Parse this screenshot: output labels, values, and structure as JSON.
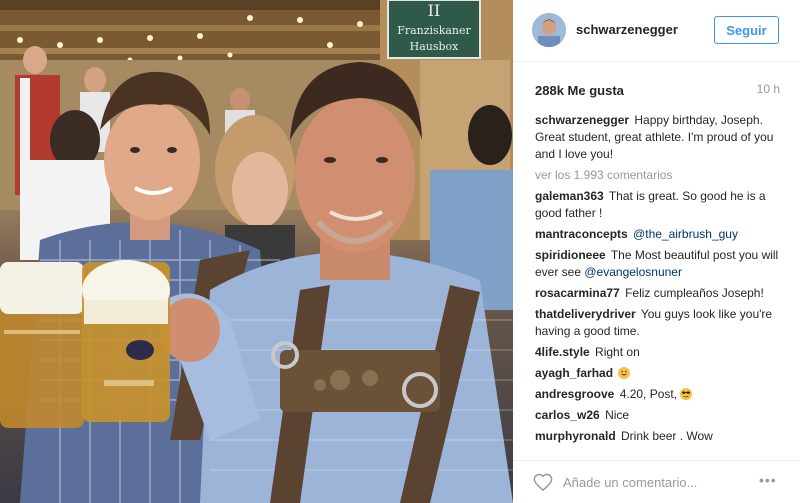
{
  "post": {
    "image_sign": {
      "line1": "Franziskaner",
      "line2": "Hausbox"
    },
    "header": {
      "username": "schwarzenegger",
      "follow_label": "Seguir"
    },
    "stats": {
      "likes": "288k Me gusta",
      "time_ago": "10 h"
    },
    "caption": {
      "user": "schwarzenegger",
      "text": "Happy birthday, Joseph. Great student, great athlete. I'm proud of you and I love you!"
    },
    "view_all_comments": "ver los 1.993 comentarios",
    "comments": [
      {
        "user": "galeman363",
        "text": "That is great. So good he is a good father !"
      },
      {
        "user": "mantraconcepts",
        "mention": "@the_airbrush_guy"
      },
      {
        "user": "spiridioneee",
        "text": "The Most beautiful post you will ever see",
        "mention": "@evangelosnuner"
      },
      {
        "user": "rosacarmina77",
        "text": "Feliz cumpleaños Joseph!"
      },
      {
        "user": "thatdeliverydriver",
        "text": "You guys look like you're having a good time."
      },
      {
        "user": "4life.style",
        "text": "Right on"
      },
      {
        "user": "ayagh_farhad",
        "emoji": "grinning-face-icon"
      },
      {
        "user": "andresgroove",
        "text": "4.20, Post,",
        "emoji": "sunglasses-face-icon"
      },
      {
        "user": "carlos_w26",
        "text": "Nice"
      },
      {
        "user": "murphyronald",
        "text": "Drink beer . Wow"
      }
    ],
    "footer": {
      "comment_placeholder": "Añade un comentario...",
      "more_label": "•••"
    },
    "colors": {
      "link_blue": "#3897f0",
      "mention_blue": "#003569",
      "muted_gray": "#999999",
      "text_dark": "#262626",
      "divider": "#efefef"
    }
  }
}
